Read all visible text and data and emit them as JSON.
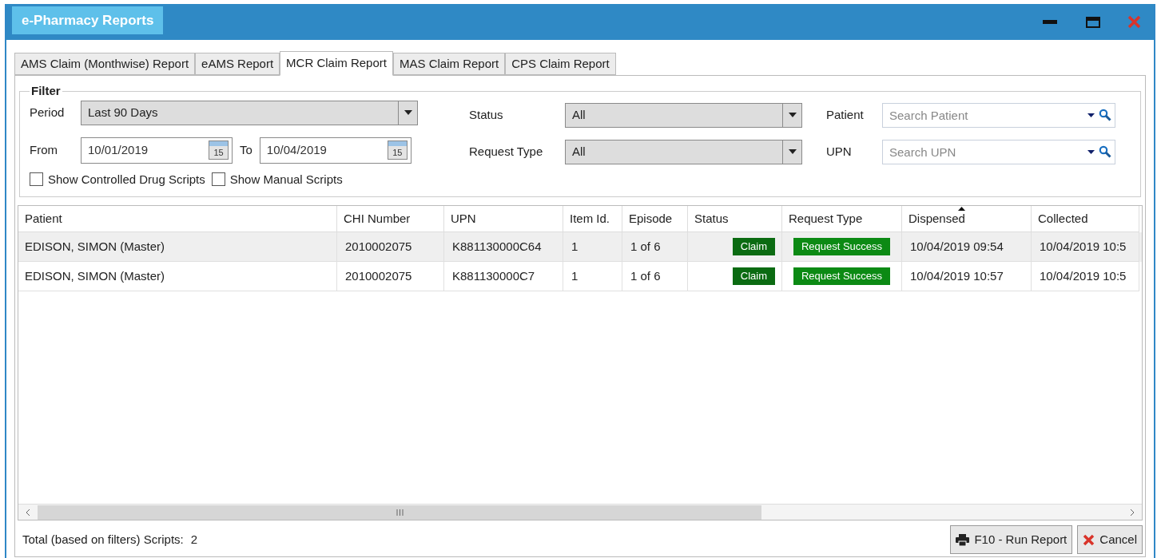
{
  "window": {
    "title": "e-Pharmacy Reports"
  },
  "tabs": [
    {
      "label": "AMS Claim (Monthwise) Report",
      "selected": false
    },
    {
      "label": "eAMS Report",
      "selected": false
    },
    {
      "label": "MCR Claim Report",
      "selected": true
    },
    {
      "label": "MAS Claim Report",
      "selected": false
    },
    {
      "label": "CPS Claim Report",
      "selected": false
    }
  ],
  "filter": {
    "title": "Filter",
    "period": {
      "label": "Period",
      "value": "Last 90 Days"
    },
    "from": {
      "label": "From",
      "value": "10/01/2019",
      "calendar_day": "15"
    },
    "to": {
      "label": "To",
      "value": "10/04/2019",
      "calendar_day": "15"
    },
    "status": {
      "label": "Status",
      "value": "All"
    },
    "request_type": {
      "label": "Request Type",
      "value": "All"
    },
    "patient": {
      "label": "Patient",
      "placeholder": "Search Patient"
    },
    "upn": {
      "label": "UPN",
      "placeholder": "Search UPN"
    },
    "checkboxes": [
      {
        "label": "Show Controlled Drug Scripts",
        "checked": false
      },
      {
        "label": "Show Manual Scripts",
        "checked": false
      }
    ]
  },
  "table": {
    "columns": [
      {
        "label": "Patient",
        "sorted": false
      },
      {
        "label": "CHI Number",
        "sorted": false
      },
      {
        "label": "UPN",
        "sorted": false
      },
      {
        "label": "Item Id.",
        "sorted": false
      },
      {
        "label": "Episode",
        "sorted": false
      },
      {
        "label": "Status",
        "sorted": false
      },
      {
        "label": "Request Type",
        "sorted": false
      },
      {
        "label": "Dispensed",
        "sorted": true
      },
      {
        "label": "Collected",
        "sorted": false
      }
    ],
    "rows": [
      {
        "selected": true,
        "cells": [
          "EDISON, SIMON (Master)",
          "2010002075",
          "K881130000C64",
          "1",
          "1 of 6",
          "Claim",
          "Request Success",
          "10/04/2019 09:54",
          "10/04/2019 10:5"
        ]
      },
      {
        "selected": false,
        "cells": [
          "EDISON, SIMON (Master)",
          "2010002075",
          "K881130000C7",
          "1",
          "1 of 6",
          "Claim",
          "Request Success",
          "10/04/2019 10:57",
          "10/04/2019 10:5"
        ]
      }
    ]
  },
  "footer": {
    "total_label": "Total (based on filters) Scripts:",
    "total": "2",
    "buttons": [
      {
        "kind": "print",
        "label": "F10 - Run Report"
      },
      {
        "kind": "cancel",
        "label": "Cancel"
      }
    ]
  }
}
